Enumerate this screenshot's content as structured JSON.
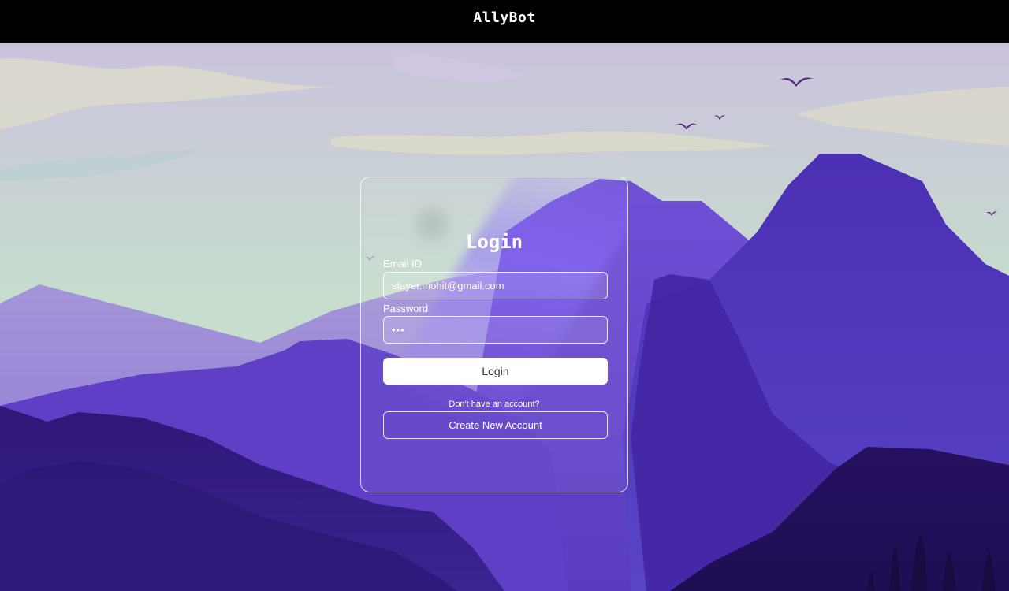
{
  "app": {
    "brand": "AllyBot"
  },
  "login_form": {
    "title": "Login",
    "email_label": "Email ID",
    "email_value": "stayer.mohit@gmail.com",
    "password_label": "Password",
    "password_value": "•••",
    "login_button_label": "Login",
    "no_account_text": "Don't have an account?",
    "create_account_button_label": "Create New Account"
  },
  "colors": {
    "topbar": "#000000",
    "sky_top": "#c9c2dd",
    "sky_bottom": "#c9e3cd",
    "mountain_light": "#7a5ce8",
    "mountain_dark": "#2a1466",
    "card_border": "#ffffff"
  }
}
